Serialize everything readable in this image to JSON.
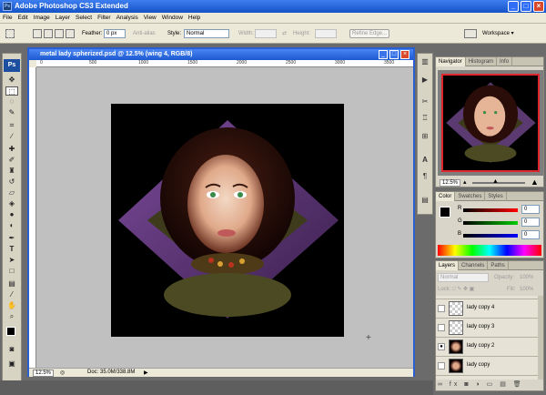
{
  "window": {
    "title": "Adobe Photoshop CS3 Extended",
    "app_badge": "Ps"
  },
  "menu": [
    "File",
    "Edit",
    "Image",
    "Layer",
    "Select",
    "Filter",
    "Analysis",
    "View",
    "Window",
    "Help"
  ],
  "options": {
    "feather_label": "Feather:",
    "feather_value": "0 px",
    "antialias_label": "Anti-alias",
    "style_label": "Style:",
    "style_value": "Normal",
    "width_label": "Width:",
    "height_label": "Height:",
    "refine_edge": "Refine Edge...",
    "workspace": "Workspace ▾"
  },
  "toolbox": {
    "logo": "Ps"
  },
  "document": {
    "title": "metal lady spherized.psd @ 12.5% (wing 4, RGB/8)",
    "zoom": "12.5%",
    "doc_info": "Doc: 35.0M/338.8M",
    "ruler_marks": [
      "0",
      "500",
      "1000",
      "1500",
      "2000",
      "2500",
      "3000",
      "3500"
    ]
  },
  "navigator": {
    "tabs": [
      "Navigator",
      "Histogram",
      "Info"
    ],
    "zoom": "12.5%"
  },
  "color_panel": {
    "tabs": [
      "Color",
      "Swatches",
      "Styles"
    ],
    "channels": [
      {
        "label": "R",
        "value": "0"
      },
      {
        "label": "G",
        "value": "0"
      },
      {
        "label": "B",
        "value": "0"
      }
    ]
  },
  "layers_panel": {
    "tabs": [
      "Layers",
      "Channels",
      "Paths"
    ],
    "blend_mode": "Normal",
    "opacity_label": "Opacity:",
    "opacity_value": "100%",
    "lock_label": "Lock:",
    "fill_label": "Fill:",
    "fill_value": "100%",
    "layers": [
      {
        "name": "lady copy 4",
        "visible": false
      },
      {
        "name": "lady copy 3",
        "visible": false
      },
      {
        "name": "lady copy 2",
        "visible": true
      },
      {
        "name": "lady copy",
        "visible": false
      }
    ]
  },
  "colors": {
    "titlebar": "#1c59d1",
    "canvas_bg": "#c0c0c0",
    "navigator_frame": "#e0262c"
  }
}
